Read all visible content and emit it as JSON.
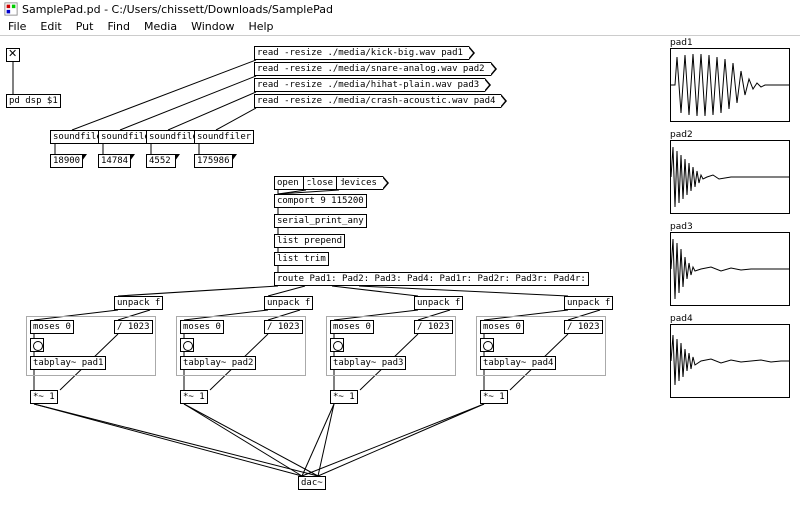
{
  "window": {
    "title": "SamplePad.pd  - C:/Users/chissett/Downloads/SamplePad",
    "app_icon": "pd-icon"
  },
  "menu": {
    "file": "File",
    "edit": "Edit",
    "put": "Put",
    "find": "Find",
    "media": "Media",
    "window": "Window",
    "help": "Help"
  },
  "read_msgs": [
    "read -resize ./media/kick-big.wav pad1",
    "read -resize ./media/snare-analog.wav pad2",
    "read -resize ./media/hihat-plain.wav pad3",
    "read -resize ./media/crash-acoustic.wav pad4"
  ],
  "soundfiler": "soundfiler",
  "soundfiler_counts": [
    "18900",
    "14784",
    "4552",
    "175986"
  ],
  "pd_dsp": "pd dsp $1",
  "comport_section": {
    "open": "open",
    "close": "close",
    "devices": "devices",
    "comport": "comport 9 115200",
    "serial_print": "serial_print_any",
    "list_prepend": "list prepend",
    "list_trim": "list trim",
    "route": "route Pad1: Pad2: Pad3: Pad4: Pad1r: Pad2r: Pad3r: Pad4r:"
  },
  "channels": [
    {
      "unpack": "unpack f",
      "moses": "moses 0",
      "div": "/ 1023",
      "tabplay": "tabplay~ pad1",
      "mult": "*~ 1"
    },
    {
      "unpack": "unpack f",
      "moses": "moses 0",
      "div": "/ 1023",
      "tabplay": "tabplay~ pad2",
      "mult": "*~ 1"
    },
    {
      "unpack": "unpack f",
      "moses": "moses 0",
      "div": "/ 1023",
      "tabplay": "tabplay~ pad3",
      "mult": "*~ 1"
    },
    {
      "unpack": "unpack f",
      "moses": "moses 0",
      "div": "/ 1023",
      "tabplay": "tabplay~ pad4",
      "mult": "*~ 1"
    }
  ],
  "dac": "dac~",
  "arrays": [
    "pad1",
    "pad2",
    "pad3",
    "pad4"
  ]
}
